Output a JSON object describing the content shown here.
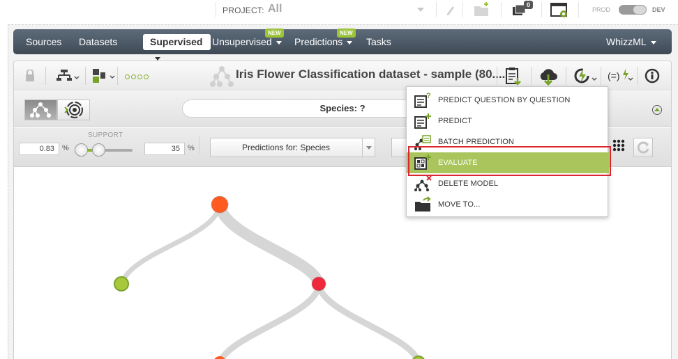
{
  "topbar": {
    "project_label": "PROJECT:",
    "project_value": "All",
    "badge_count": "0",
    "prod_label": "PROD",
    "dev_label": "DEV"
  },
  "nav": {
    "items": [
      "Sources",
      "Datasets",
      "Supervised",
      "Unsupervised",
      "Predictions",
      "Tasks"
    ],
    "active": "Supervised",
    "new_badge": "NEW",
    "right": "WhizzML"
  },
  "toolbar": {
    "dataset_title": "Iris Flower Classification dataset - sample (80...."
  },
  "prediction_bar": {
    "label": "Species: ?"
  },
  "filters": {
    "confidence_value": "0.83",
    "confidence_unit": "%",
    "support_label": "SUPPORT",
    "support_value": "35",
    "support_unit": "%",
    "predictions_for": "Predictions for: Species"
  },
  "menu": {
    "items": [
      {
        "label": "PREDICT QUESTION BY QUESTION",
        "icon": "predict-question-icon"
      },
      {
        "label": "PREDICT",
        "icon": "predict-icon"
      },
      {
        "label": "BATCH PREDICTION",
        "icon": "batch-prediction-icon"
      },
      {
        "label": "EVALUATE",
        "icon": "evaluate-icon"
      },
      {
        "label": "DELETE MODEL",
        "icon": "delete-model-icon"
      },
      {
        "label": "MOVE TO...",
        "icon": "move-to-icon"
      }
    ],
    "highlighted": "EVALUATE"
  },
  "colors": {
    "nav_bg": "#4b5764",
    "accent_green": "#9cc43a",
    "highlight": "#a9c55b",
    "outline_red": "#d9262f",
    "node_orange": "#ff5a1f",
    "node_red": "#f0283c",
    "node_green": "#a8c83c"
  }
}
